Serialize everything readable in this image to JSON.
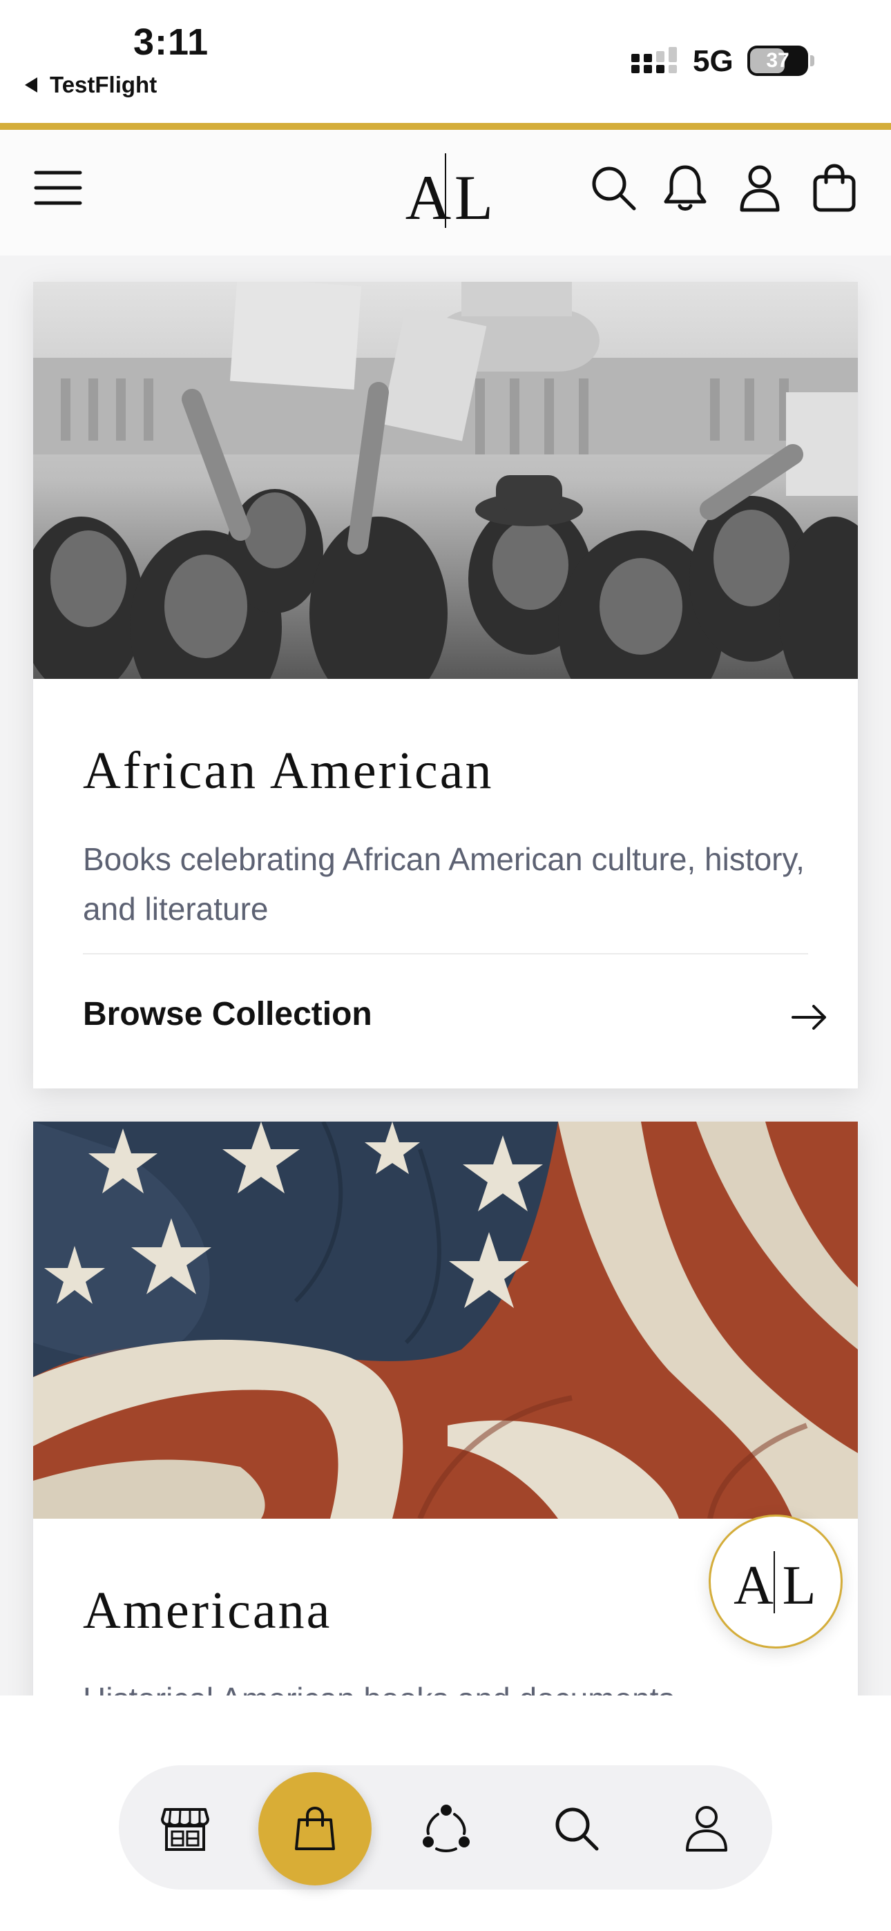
{
  "status_bar": {
    "time": "3:11",
    "back_app": "TestFlight",
    "network": "5G",
    "battery": "37"
  },
  "header": {
    "logo_left": "A",
    "logo_right": "L",
    "icons": [
      "menu-icon",
      "search-icon",
      "bell-icon",
      "user-icon",
      "bag-icon"
    ]
  },
  "cards": [
    {
      "title": "African American",
      "description": "Books celebrating African American culture, history, and literature",
      "link": "Browse Collection"
    },
    {
      "title": "Americana",
      "description": "Historical American books and documents"
    }
  ],
  "bottom_nav": {
    "items": [
      "store-icon",
      "bag-icon",
      "community-icon",
      "search-icon",
      "profile-icon"
    ],
    "active_index": 1
  },
  "colors": {
    "gold": "#d4ad3a",
    "tab_active": "#d9ad36",
    "text_muted": "#5d6273"
  }
}
